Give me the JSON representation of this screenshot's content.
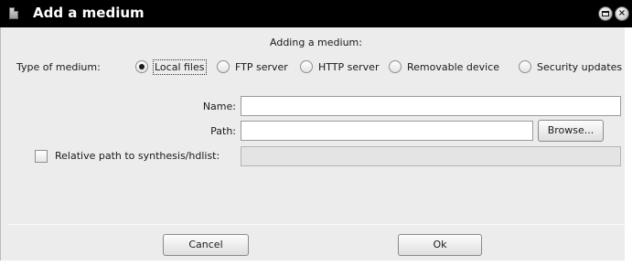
{
  "window": {
    "title": "Add a medium",
    "app_icon": "document-icon",
    "minimize_icon": "minimize-icon",
    "close_icon": "close-icon",
    "close_glyph": "×"
  },
  "dialog": {
    "header": "Adding a medium:",
    "type_label": "Type of medium:",
    "medium_types": [
      {
        "label": "Local files",
        "checked": true
      },
      {
        "label": "FTP server",
        "checked": false
      },
      {
        "label": "HTTP server",
        "checked": false
      },
      {
        "label": "Removable device",
        "checked": false
      },
      {
        "label": "Security updates",
        "checked": false
      }
    ],
    "name_label": "Name:",
    "name_value": "",
    "path_label": "Path:",
    "path_value": "",
    "browse_label": "Browse...",
    "relative_path_label": "Relative path to synthesis/hdlist:",
    "relative_path_checked": false,
    "relative_path_value": ""
  },
  "footer": {
    "cancel_label": "Cancel",
    "ok_label": "Ok"
  }
}
